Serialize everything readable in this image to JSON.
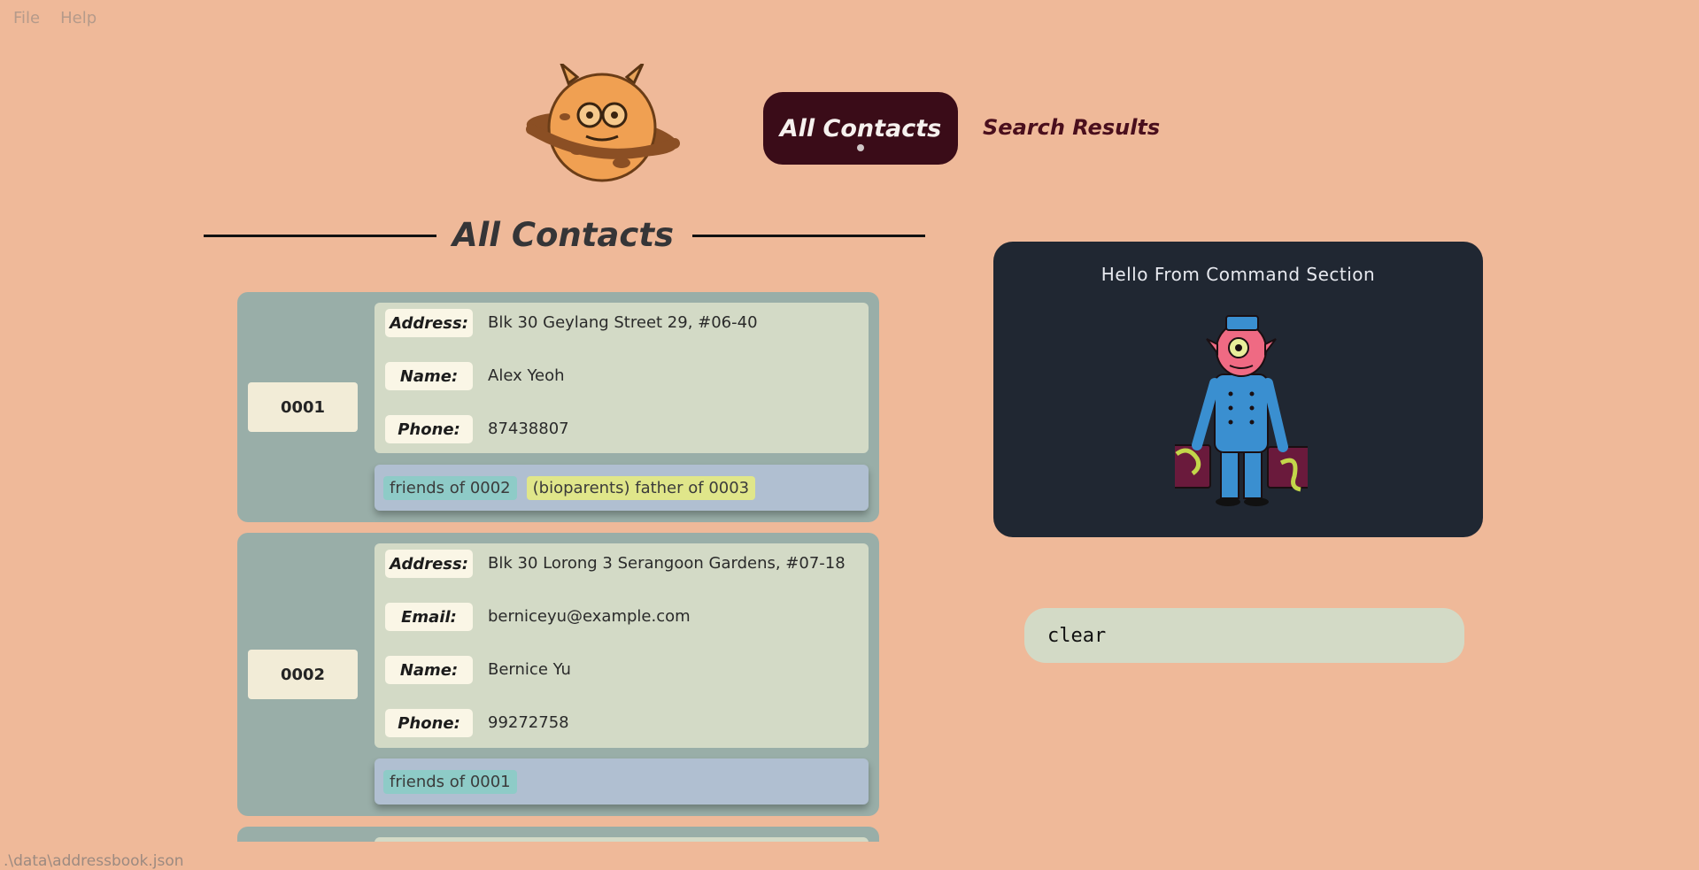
{
  "menu": {
    "items": [
      "File",
      "Help"
    ]
  },
  "tabs": {
    "active": "All Contacts",
    "inactive": "Search Results"
  },
  "list": {
    "title": "All Contacts",
    "contacts": [
      {
        "id": "0001",
        "fields": [
          {
            "label": "Address:",
            "value": "Blk 30 Geylang Street 29, #06-40"
          },
          {
            "label": "Name:",
            "value": "Alex Yeoh"
          },
          {
            "label": "Phone:",
            "value": "87438807"
          }
        ],
        "tags": [
          {
            "text": "friends of 0002",
            "kind": "friend"
          },
          {
            "text": "(bioparents) father of 0003",
            "kind": "parent"
          }
        ]
      },
      {
        "id": "0002",
        "fields": [
          {
            "label": "Address:",
            "value": "Blk 30 Lorong 3 Serangoon Gardens, #07-18"
          },
          {
            "label": "Email:",
            "value": "berniceyu@example.com"
          },
          {
            "label": "Name:",
            "value": "Bernice Yu"
          },
          {
            "label": "Phone:",
            "value": "99272758"
          }
        ],
        "tags": [
          {
            "text": "friends of 0001",
            "kind": "friend"
          }
        ]
      },
      {
        "id": "",
        "fields": [],
        "tags": []
      }
    ]
  },
  "command": {
    "greeting": "Hello From Command Section",
    "input_value": "clear"
  },
  "status_bar": {
    "path": ".\\data\\addressbook.json"
  },
  "icons": {
    "logo": "planet-monster-logo-icon",
    "mascot": "bellhop-monster-icon"
  }
}
